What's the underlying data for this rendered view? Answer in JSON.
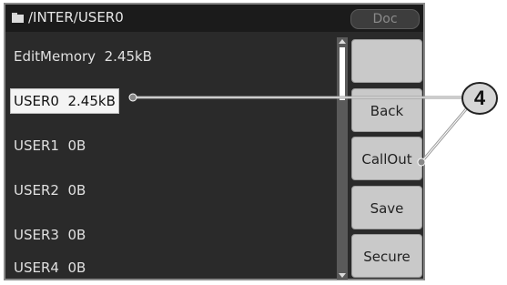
{
  "header": {
    "folder_icon": "folder-icon",
    "path": "/INTER/USER0",
    "doc_label": "Doc"
  },
  "files": [
    {
      "label": "EditMemory  2.45kB",
      "selected": false
    },
    {
      "label": "USER0  2.45kB",
      "selected": true
    },
    {
      "label": "USER1  0B",
      "selected": false
    },
    {
      "label": "USER2  0B",
      "selected": false
    },
    {
      "label": "USER3  0B",
      "selected": false
    },
    {
      "label": "USER4  0B",
      "selected": false
    }
  ],
  "softkeys": [
    "",
    "Back",
    "CallOut",
    "Save",
    "Secure"
  ],
  "callout": {
    "number": "4"
  },
  "colors": {
    "screen_bg": "#2a2a2a",
    "selection_bg": "#f4f4f4",
    "softkey_bg": "#c9c9c9"
  }
}
